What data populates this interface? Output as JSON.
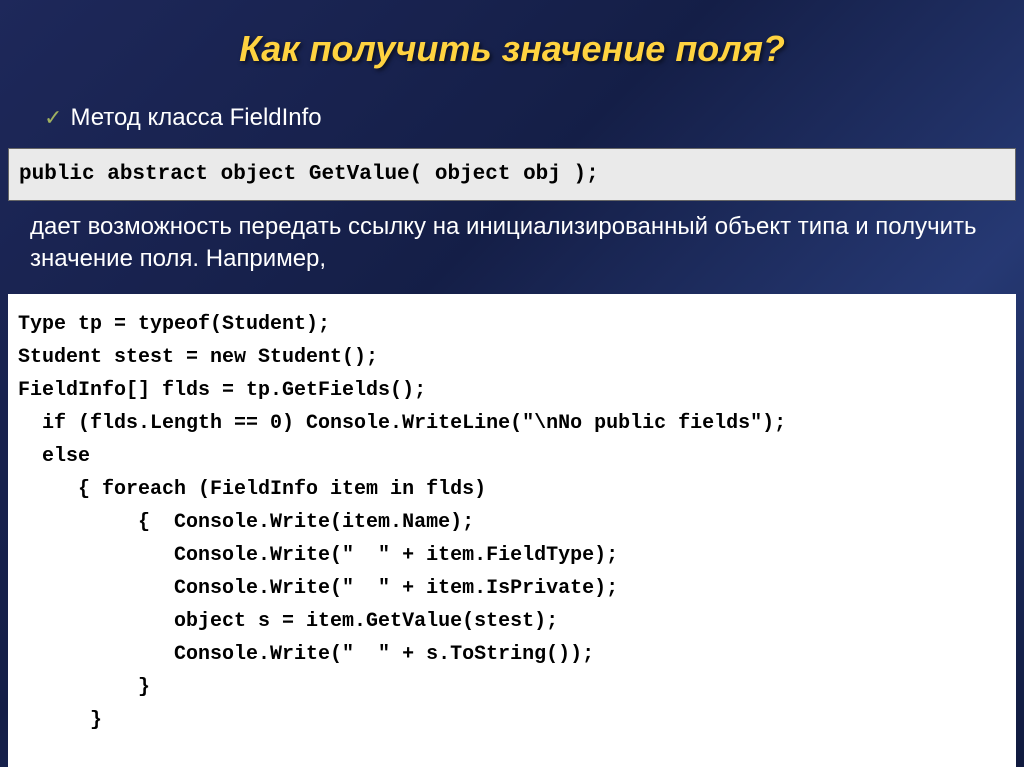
{
  "title": "Как получить значение поля?",
  "bullet": "Метод класса FieldInfo",
  "codeTop": "public abstract object GetValue( object obj );",
  "description": "дает возможность передать ссылку на инициализированный объект типа и получить значение поля. Например,",
  "codeMain": "Type tp = typeof(Student);\nStudent stest = new Student();\nFieldInfo[] flds = tp.GetFields();\n  if (flds.Length == 0) Console.WriteLine(\"\\nNo public fields\");\n  else\n     { foreach (FieldInfo item in flds)\n          {  Console.Write(item.Name);\n             Console.Write(\"  \" + item.FieldType);\n             Console.Write(\"  \" + item.IsPrivate);\n             object s = item.GetValue(stest);\n             Console.Write(\"  \" + s.ToString());\n          }\n      }"
}
